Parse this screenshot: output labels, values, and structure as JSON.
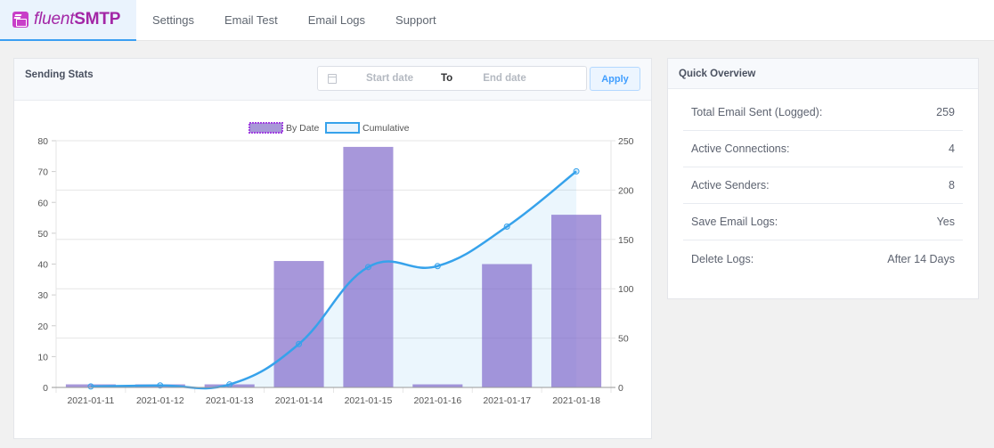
{
  "brand": {
    "light": "fluent",
    "bold": "SMTP"
  },
  "nav": [
    "Settings",
    "Email Test",
    "Email Logs",
    "Support"
  ],
  "sending_stats": {
    "title": "Sending Stats",
    "start_placeholder": "Start date",
    "to_label": "To",
    "end_placeholder": "End date",
    "apply_label": "Apply"
  },
  "quick_overview": {
    "title": "Quick Overview",
    "rows": [
      {
        "label": "Total Email Sent (Logged):",
        "value": "259"
      },
      {
        "label": "Active Connections:",
        "value": "4"
      },
      {
        "label": "Active Senders:",
        "value": "8"
      },
      {
        "label": "Save Email Logs:",
        "value": "Yes"
      },
      {
        "label": "Delete Logs:",
        "value": "After 14 Days"
      }
    ]
  },
  "colors": {
    "brand": "#a326a6",
    "bar": "#9b89d4",
    "line": "#36a2eb",
    "accent": "#409eff"
  },
  "chart_data": {
    "type": "bar",
    "categories": [
      "2021-01-11",
      "2021-01-12",
      "2021-01-13",
      "2021-01-14",
      "2021-01-15",
      "2021-01-16",
      "2021-01-17",
      "2021-01-18"
    ],
    "series": [
      {
        "name": "By Date",
        "type": "bar",
        "axis": "left",
        "values": [
          1,
          1,
          1,
          41,
          78,
          1,
          40,
          56
        ]
      },
      {
        "name": "Cumulative",
        "type": "line",
        "axis": "right",
        "values": [
          1,
          2,
          3,
          44,
          122,
          123,
          163,
          219
        ]
      }
    ],
    "legend": [
      "By Date",
      "Cumulative"
    ],
    "legend_position": "top",
    "y_left": {
      "min": 0,
      "max": 80,
      "ticks": [
        0,
        10,
        20,
        30,
        40,
        50,
        60,
        70,
        80
      ]
    },
    "y_right": {
      "min": 0,
      "max": 250,
      "ticks": [
        0,
        50,
        100,
        150,
        200,
        250
      ]
    },
    "grid": true,
    "title": "",
    "xlabel": "",
    "ylabel": ""
  }
}
